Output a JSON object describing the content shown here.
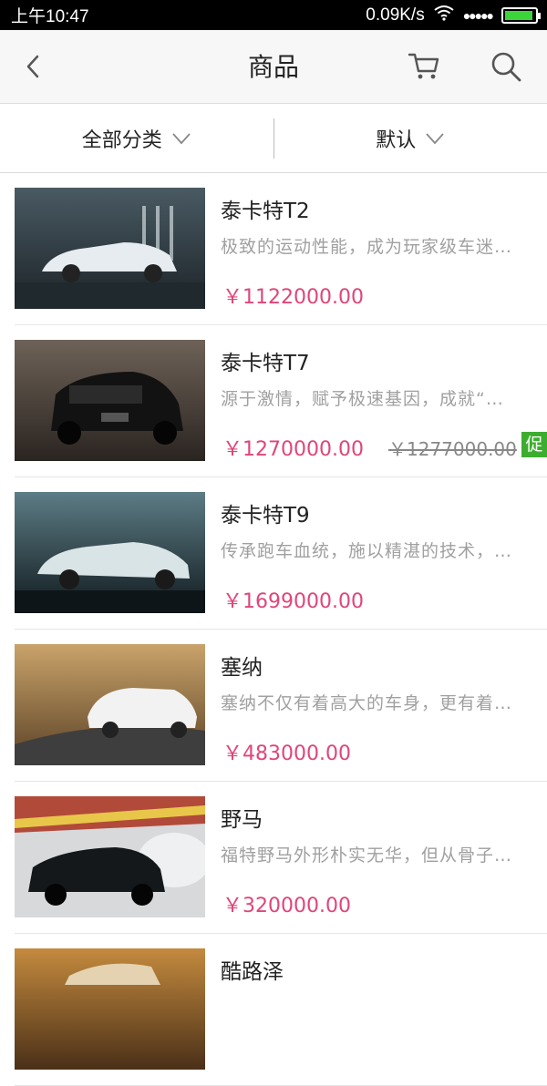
{
  "status_bar": {
    "time": "上午10:47",
    "net_speed": "0.09K/s",
    "signal_dots": "●●●●●",
    "battery_level": 0.95,
    "battery_color": "#3bd43b"
  },
  "nav": {
    "title": "商品",
    "back_icon": "chevron-left-icon",
    "cart_icon": "cart-icon",
    "search_icon": "search-icon"
  },
  "filters": {
    "category_label": "全部分类",
    "sort_label": "默认"
  },
  "colors": {
    "price": "#e0457b",
    "promo": "#3dad2f"
  },
  "products": [
    {
      "name": "泰卡特T2",
      "desc": "极致的运动性能，成为玩家级车迷…",
      "price": "￥1122000.00",
      "original_price": "",
      "promo": ""
    },
    {
      "name": "泰卡特T7",
      "desc": "源于激情，赋予极速基因，成就“…",
      "price": "￥1270000.00",
      "original_price": "￥1277000.00",
      "promo": "促"
    },
    {
      "name": "泰卡特T9",
      "desc": "传承跑车血统，施以精湛的技术，…",
      "price": "￥1699000.00",
      "original_price": "",
      "promo": ""
    },
    {
      "name": "塞纳",
      "desc": "塞纳不仅有着高大的车身，更有着…",
      "price": "￥483000.00",
      "original_price": "",
      "promo": ""
    },
    {
      "name": "野马",
      "desc": "福特野马外形朴实无华，但从骨子…",
      "price": "￥320000.00",
      "original_price": "",
      "promo": ""
    },
    {
      "name": "酷路泽",
      "desc": "",
      "price": "",
      "original_price": "",
      "promo": ""
    }
  ]
}
